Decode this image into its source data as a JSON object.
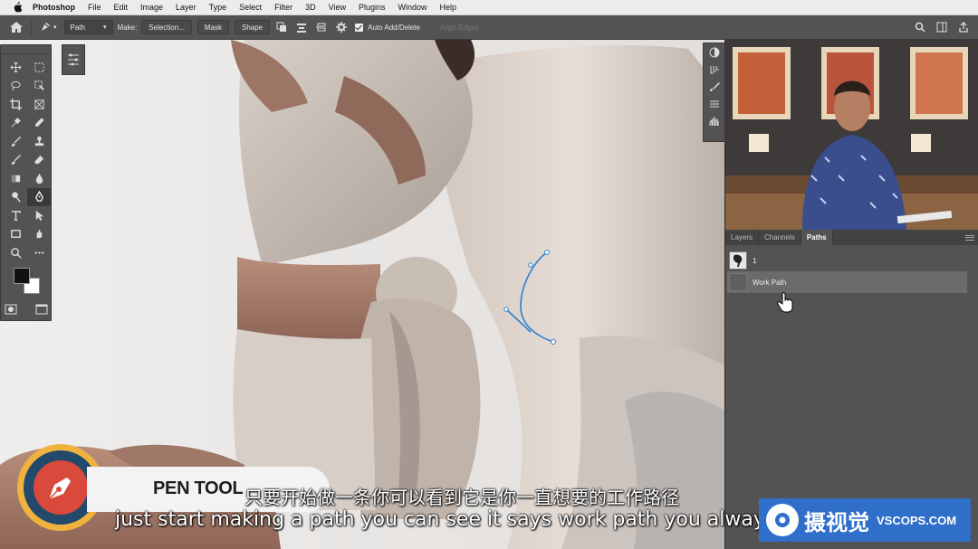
{
  "menubar": {
    "app": "Photoshop",
    "items": [
      "File",
      "Edit",
      "Image",
      "Layer",
      "Type",
      "Select",
      "Filter",
      "3D",
      "View",
      "Plugins",
      "Window",
      "Help"
    ]
  },
  "options": {
    "mode_select": "Path",
    "make_label": "Make:",
    "selection_btn": "Selection...",
    "mask_btn": "Mask",
    "shape_btn": "Shape",
    "auto_add_delete": "Auto Add/Delete",
    "align_edges": "Align Edges"
  },
  "paths_panel": {
    "tabs": [
      "Layers",
      "Channels",
      "Paths"
    ],
    "active_tab": "Paths",
    "rows": [
      {
        "name": "1"
      },
      {
        "name": "Work Path"
      }
    ]
  },
  "overlay": {
    "lower_third": "PEN TOOL",
    "subtitle_cn": "只要开始做一条你可以看到它是你一直想要的工作路径",
    "subtitle_en": "just start making a path you can see it says work path you always w",
    "logo_cn": "摄视觉",
    "logo_en": "VSCOPS.COM"
  },
  "colors": {
    "accent_path": "#2f7fd1",
    "panel_bg": "#535353"
  }
}
